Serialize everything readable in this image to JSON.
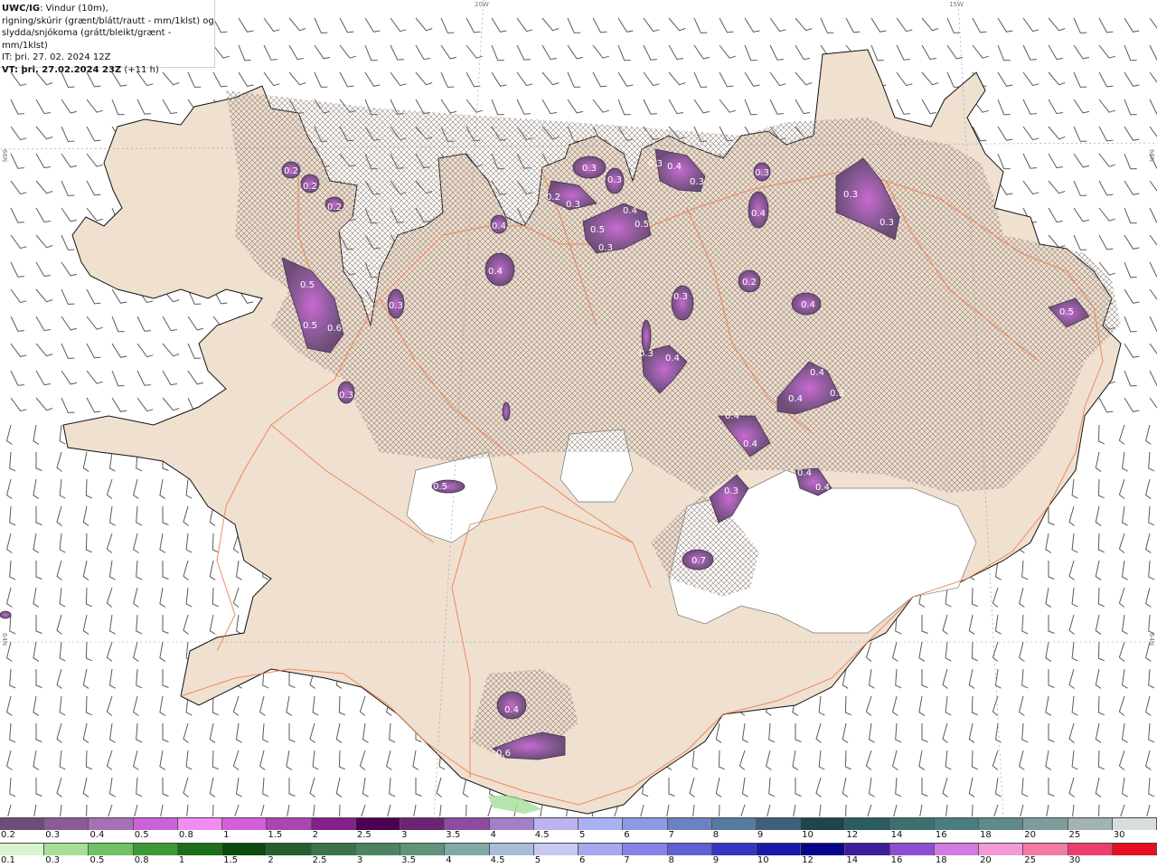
{
  "header": {
    "line1_bold": "UWC/IG",
    "line1_rest": ": Vindur (10m),",
    "line2": "rigning/skúrir (grænt/blátt/rautt - mm/1klst) og",
    "line3": "slydda/snjókoma (grátt/bleikt/grænt - mm/1klst)",
    "line4": "IT: þri. 27. 02. 2024 12Z",
    "line5_bold": "VT: þri. 27.02.2024 23Z",
    "line5_rest": " (+11 h)"
  },
  "grid_labels": {
    "lon_20w": "20W",
    "lon_15w": "15W",
    "lat_66n_left": "66N",
    "lat_66n_right": "66N",
    "lat_64n_left": "64N",
    "lat_64n_right": "64N"
  },
  "precip_values": [
    {
      "label": "0.2"
    },
    {
      "label": "0.2"
    },
    {
      "label": "0.2"
    },
    {
      "label": "0.5"
    },
    {
      "label": "0.5"
    },
    {
      "label": "0.6"
    },
    {
      "label": "0.3"
    },
    {
      "label": "0.3"
    },
    {
      "label": "0.4"
    },
    {
      "label": "0.4"
    },
    {
      "label": "0.3"
    },
    {
      "label": "0.2"
    },
    {
      "label": "0.3"
    },
    {
      "label": "0.3"
    },
    {
      "label": "0.4"
    },
    {
      "label": "0.5"
    },
    {
      "label": "0.5"
    },
    {
      "label": "0.3"
    },
    {
      "label": "0.3"
    },
    {
      "label": "0.4"
    },
    {
      "label": "0.3"
    },
    {
      "label": "0.3"
    },
    {
      "label": "0.4"
    },
    {
      "label": "0.3"
    },
    {
      "label": "0.3"
    },
    {
      "label": "0.2"
    },
    {
      "label": "0.3"
    },
    {
      "label": "0.4"
    },
    {
      "label": "0.5"
    },
    {
      "label": "0.3"
    },
    {
      "label": "0.4"
    },
    {
      "label": "0.4"
    },
    {
      "label": "0.4"
    },
    {
      "label": "0.3"
    },
    {
      "label": "0.4"
    },
    {
      "label": "0.4"
    },
    {
      "label": "0.4"
    },
    {
      "label": "0.4"
    },
    {
      "label": "0.3"
    },
    {
      "label": "0.7"
    },
    {
      "label": "0.5"
    },
    {
      "label": "0.4"
    },
    {
      "label": "0.6"
    }
  ],
  "legend_snow": {
    "labels": [
      "0.2",
      "0.3",
      "0.4",
      "0.5",
      "0.8",
      "1",
      "1.5",
      "2",
      "2.5",
      "3",
      "3.5",
      "4",
      "4.5",
      "5",
      "6",
      "7",
      "8",
      "9",
      "10",
      "12",
      "14",
      "16",
      "18",
      "20",
      "25",
      "30"
    ],
    "colors": [
      "#6e4e78",
      "#8c5a9a",
      "#a86fb8",
      "#cc62d8",
      "#f28cf5",
      "#d55fd8",
      "#a946b2",
      "#851f8c",
      "#4b0052",
      "#6b2574",
      "#8c4da0",
      "#a47fc8",
      "#bcb3f0",
      "#aab1f2",
      "#8d99e4",
      "#6e80c4",
      "#577aa0",
      "#3f5f7a",
      "#1e454e",
      "#2a5c62",
      "#3d6f6f",
      "#4a7e7e",
      "#5f8a8a",
      "#7e9c9c",
      "#a3b3b3",
      "#d6dede"
    ]
  },
  "legend_rain": {
    "labels": [
      "0.1",
      "0.3",
      "0.5",
      "0.8",
      "1",
      "1.5",
      "2",
      "2.5",
      "3",
      "3.5",
      "4",
      "4.5",
      "5",
      "6",
      "7",
      "8",
      "9",
      "10",
      "12",
      "14",
      "16",
      "18",
      "20",
      "25",
      "30"
    ],
    "colors": [
      "#d8f5d0",
      "#a5df98",
      "#6fc163",
      "#3d9a36",
      "#1d6e19",
      "#0a4a0b",
      "#265f2e",
      "#3a7448",
      "#4c8462",
      "#5f9479",
      "#80a9a6",
      "#a8bdd8",
      "#c7c9f4",
      "#a9a7ef",
      "#8683e6",
      "#5e60d4",
      "#3535c2",
      "#1a1aa8",
      "#06068a",
      "#3f1c9c",
      "#8b4fcf",
      "#d27ae3",
      "#f39ad6",
      "#f27ba8",
      "#ee3e6e",
      "#e60f22"
    ]
  },
  "colors": {
    "land": "#efe0d0",
    "ice_cap": "#ffffff",
    "roads": "#f08050",
    "coast": "#111111",
    "wind_barbs": "#555555",
    "hatch": "#9a8a82"
  }
}
